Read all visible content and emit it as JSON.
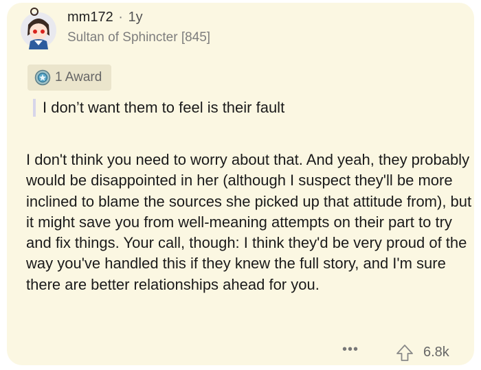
{
  "comment": {
    "username": "mm172",
    "separator": "·",
    "age": "1y",
    "flair": "Sultan of Sphincter [845]",
    "award_label": "1 Award",
    "quote": "I don’t want them to feel is their fault",
    "body": "I don't think you need to worry about that.  And yeah, they probably would be disappointed in her (although I suspect they'll be more inclined to blame the sources she picked up that attitude from), but it might save you from well-meaning attempts on their part to try and fix things.  Your call, though: I think they'd be very proud of the way you've handled this if they knew the full story, and I'm sure there are better relationships ahead for you.",
    "more_label": "•••",
    "score": "6.8k"
  },
  "icons": {
    "avatar": "avatar-icon",
    "award": "award-icon",
    "upvote": "upvote-arrow-icon",
    "more": "more-options-icon"
  },
  "colors": {
    "card_background": "#fbf7e2",
    "award_chip_background": "#ebe5cc",
    "quote_bar": "#d7d5ea",
    "text_primary": "#1a1a1a",
    "text_secondary": "#7d7d7d"
  }
}
